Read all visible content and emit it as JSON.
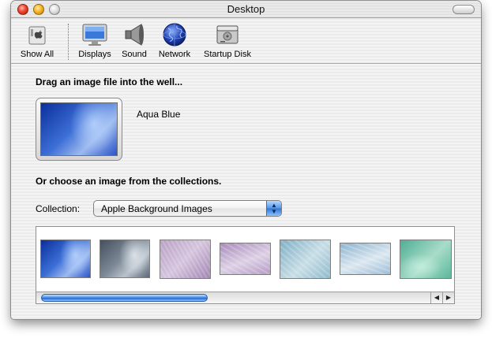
{
  "window": {
    "title": "Desktop"
  },
  "toolbar": {
    "items": [
      {
        "label": "Show All",
        "icon": "apple-switch-icon"
      },
      {
        "label": "Displays",
        "icon": "display-monitor-icon"
      },
      {
        "label": "Sound",
        "icon": "speaker-icon"
      },
      {
        "label": "Network",
        "icon": "globe-icon"
      },
      {
        "label": "Startup Disk",
        "icon": "hard-disk-icon"
      }
    ]
  },
  "well": {
    "heading": "Drag an image file into the well...",
    "image_name": "Aqua Blue"
  },
  "collections": {
    "heading": "Or choose an image from the collections.",
    "label": "Collection:",
    "selected": "Apple Background Images"
  },
  "colors": {
    "accent": "#3b86e0",
    "window_bg": "#efefef"
  }
}
